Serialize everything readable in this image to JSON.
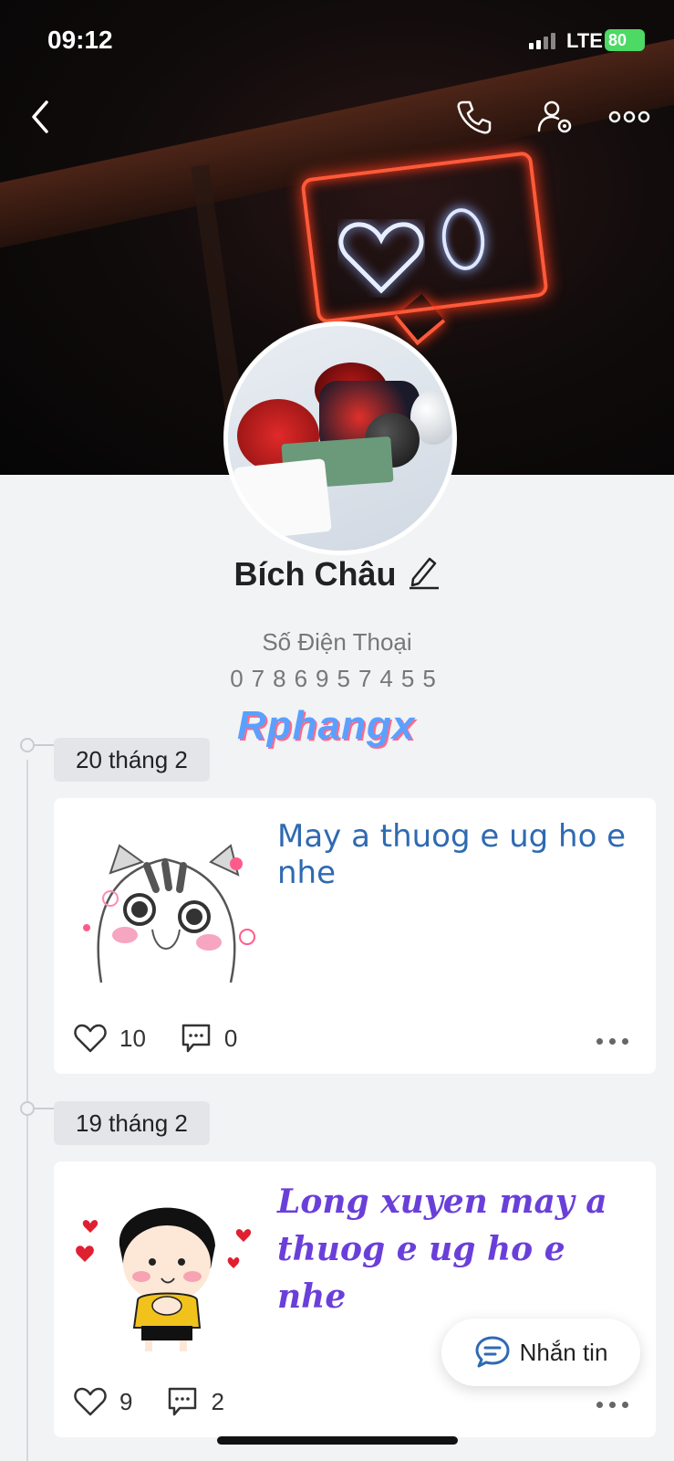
{
  "status_bar": {
    "time": "09:12",
    "carrier": "LTE",
    "battery": "80"
  },
  "header": {
    "back_icon": "chevron-left-icon",
    "call_icon": "phone-icon",
    "settings_icon": "user-settings-icon",
    "more_icon": "more-horizontal-icon"
  },
  "profile": {
    "name": "Bích Châu",
    "phone_label": "Số Điện Thoại",
    "phone_number": "0786957455",
    "watermark": "Rphangx"
  },
  "timeline": [
    {
      "date": "20 tháng 2",
      "text": "May a thuog e ug ho e nhe",
      "likes": "10",
      "comments": "0"
    },
    {
      "date": "19 tháng 2",
      "text": "Long xuyen may a thuog e ug ho e nhe",
      "likes": "9",
      "comments": "2"
    }
  ],
  "message_button": {
    "label": "Nhắn tin"
  },
  "colors": {
    "accent_blue": "#2f6ab2",
    "accent_purple": "#6a3fd9",
    "battery_green": "#4cd964"
  }
}
